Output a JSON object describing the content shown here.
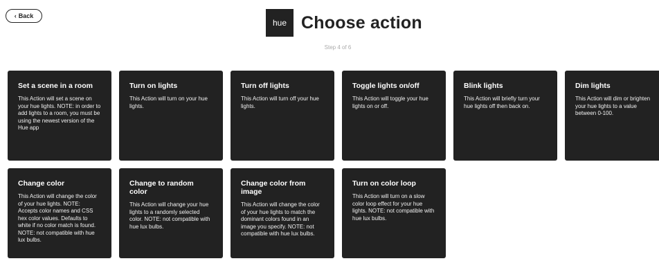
{
  "back": {
    "label": "Back"
  },
  "header": {
    "logo_text": "hue",
    "title": "Choose action",
    "step": "Step 4 of 6"
  },
  "actions": [
    {
      "title": "Set a scene in a room",
      "description": "This Action will set a scene on your hue lights. NOTE: in order to add lights to a room, you must be using the newest version of the Hue app"
    },
    {
      "title": "Turn on lights",
      "description": "This Action will turn on your hue lights."
    },
    {
      "title": "Turn off lights",
      "description": "This Action will turn off your hue lights."
    },
    {
      "title": "Toggle lights on/off",
      "description": "This Action will toggle your hue lights on or off."
    },
    {
      "title": "Blink lights",
      "description": "This Action will briefly turn your hue lights off then back on."
    },
    {
      "title": "Dim lights",
      "description": "This Action will dim or brighten your hue lights to a value between 0-100."
    },
    {
      "title": "Change color",
      "description": "This Action will change the color of your hue lights. NOTE: Accepts color names and CSS hex color values. Defaults to white if no color match is found. NOTE: not compatible with hue lux bulbs."
    },
    {
      "title": "Change to random color",
      "description": "This Action will change your hue lights to a randomly selected color. NOTE: not compatible with hue lux bulbs."
    },
    {
      "title": "Change color from image",
      "description": "This Action will change the color of your hue lights to match the dominant colors found in an image you specify. NOTE: not compatible with hue lux bulbs."
    },
    {
      "title": "Turn on color loop",
      "description": "This Action will turn on a slow color loop effect for your hue lights. NOTE: not compatible with hue lux bulbs."
    }
  ]
}
